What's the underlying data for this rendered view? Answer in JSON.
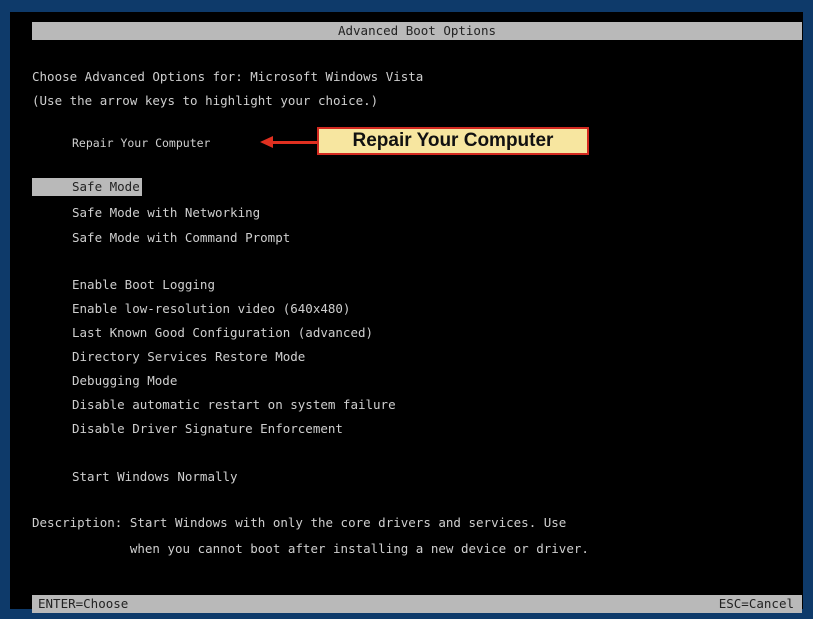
{
  "title": "Advanced Boot Options",
  "header": {
    "line1": "Choose Advanced Options for: Microsoft Windows Vista",
    "line2": "(Use the arrow keys to highlight your choice.)"
  },
  "repair": {
    "label": "Repair Your Computer",
    "callout": "Repair Your Computer"
  },
  "safe_group": [
    "Safe Mode",
    "Safe Mode with Networking",
    "Safe Mode with Command Prompt"
  ],
  "advanced_group": [
    "Enable Boot Logging",
    "Enable low-resolution video (640x480)",
    "Last Known Good Configuration (advanced)",
    "Directory Services Restore Mode",
    "Debugging Mode",
    "Disable automatic restart on system failure",
    "Disable Driver Signature Enforcement"
  ],
  "normal": "Start Windows Normally",
  "description": {
    "line1": "Description: Start Windows with only the core drivers and services. Use",
    "line2": "             when you cannot boot after installing a new device or driver."
  },
  "footer": {
    "left": "ENTER=Choose",
    "right": "ESC=Cancel"
  },
  "selected": "Safe Mode",
  "colors": {
    "bar_gray": "#b9b9b9",
    "text": "#cfcfcf",
    "callout_fill": "#f7e6a0",
    "callout_border": "#d42a20"
  }
}
